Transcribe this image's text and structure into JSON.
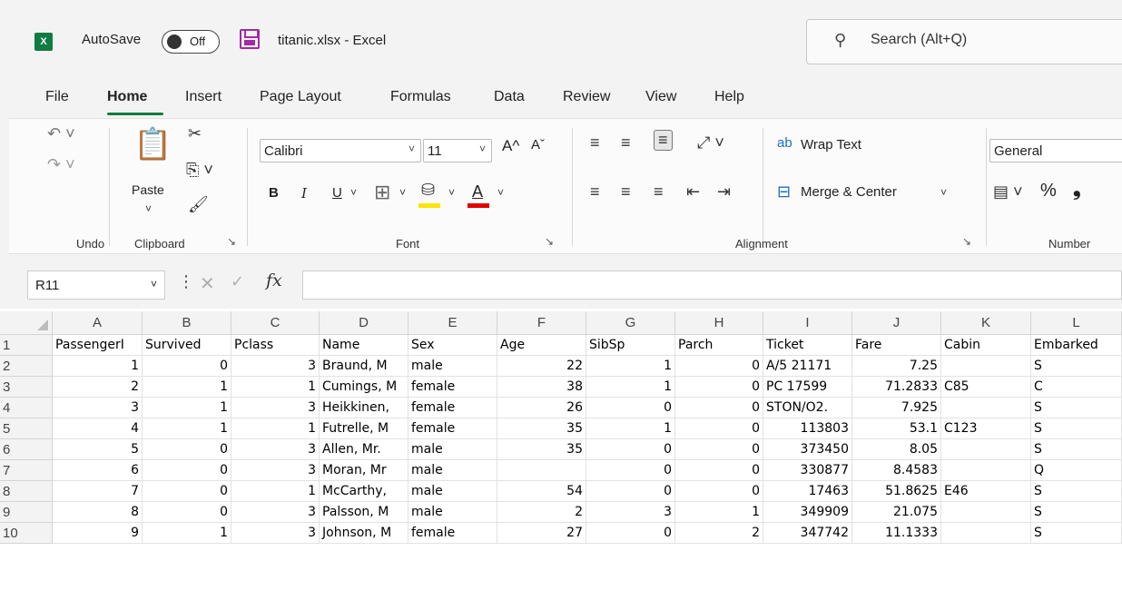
{
  "window": {
    "app_icon": "X",
    "autosave_label": "AutoSave",
    "autosave_state": "Off",
    "filename": "titanic.xlsx  -  Excel",
    "search_placeholder": "Search (Alt+Q)"
  },
  "menu_tabs": [
    "File",
    "Home",
    "Insert",
    "Page Layout",
    "Formulas",
    "Data",
    "Review",
    "View",
    "Help"
  ],
  "ribbon": {
    "undo_group": "Undo",
    "clipboard_group": "Clipboard",
    "paste_label": "Paste",
    "font_group": "Font",
    "font_name": "Calibri",
    "font_size": "11",
    "alignment_group": "Alignment",
    "wrap_text": "Wrap Text",
    "merge_center": "Merge & Center",
    "number_group": "Number",
    "number_format": "General",
    "bold": "B",
    "italic": "I",
    "underline": "U",
    "font_color_letter": "A",
    "percent": "%",
    "comma": "❟",
    "grow_font": "A^",
    "shrink_font": "Aˇ",
    "highlight_color": "#ffe400",
    "font_color": "#e00000"
  },
  "formula_bar": {
    "name_box": "R11",
    "formula": ""
  },
  "grid": {
    "columns": [
      "A",
      "B",
      "C",
      "D",
      "E",
      "F",
      "G",
      "H",
      "I",
      "J",
      "K",
      "L"
    ],
    "rows": [
      [
        "PassengerI",
        "Survived",
        "Pclass",
        "Name",
        "Sex",
        "Age",
        "SibSp",
        "Parch",
        "Ticket",
        "Fare",
        "Cabin",
        "Embarked"
      ],
      [
        "1",
        "0",
        "3",
        "Braund, M",
        "male",
        "22",
        "1",
        "0",
        "A/5 21171",
        "7.25",
        "",
        "S"
      ],
      [
        "2",
        "1",
        "1",
        "Cumings, M",
        "female",
        "38",
        "1",
        "0",
        "PC 17599",
        "71.2833",
        "C85",
        "C"
      ],
      [
        "3",
        "1",
        "3",
        "Heikkinen,",
        "female",
        "26",
        "0",
        "0",
        "STON/O2.",
        "7.925",
        "",
        "S"
      ],
      [
        "4",
        "1",
        "1",
        "Futrelle, M",
        "female",
        "35",
        "1",
        "0",
        "113803",
        "53.1",
        "C123",
        "S"
      ],
      [
        "5",
        "0",
        "3",
        "Allen, Mr. ",
        "male",
        "35",
        "0",
        "0",
        "373450",
        "8.05",
        "",
        "S"
      ],
      [
        "6",
        "0",
        "3",
        "Moran, Mr",
        "male",
        "",
        "0",
        "0",
        "330877",
        "8.4583",
        "",
        "Q"
      ],
      [
        "7",
        "0",
        "1",
        "McCarthy,",
        "male",
        "54",
        "0",
        "0",
        "17463",
        "51.8625",
        "E46",
        "S"
      ],
      [
        "8",
        "0",
        "3",
        "Palsson, M",
        "male",
        "2",
        "3",
        "1",
        "349909",
        "21.075",
        "",
        "S"
      ],
      [
        "9",
        "1",
        "3",
        "Johnson, M",
        "female",
        "27",
        "0",
        "2",
        "347742",
        "11.1333",
        "",
        "S"
      ]
    ],
    "row_numbers": [
      "1",
      "2",
      "3",
      "4",
      "5",
      "6",
      "7",
      "8",
      "9",
      "10"
    ]
  }
}
